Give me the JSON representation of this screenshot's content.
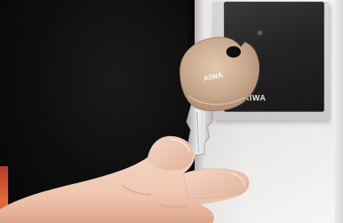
{
  "image": {
    "panel_brand": "AIWA",
    "key_brand": "AIWA"
  },
  "colors": {
    "key_head": "#c9a98e",
    "key_blade": "#d8d8d8",
    "skin": "#f0cdb8",
    "panel": "#232325",
    "wall": "#f2f1f0"
  }
}
